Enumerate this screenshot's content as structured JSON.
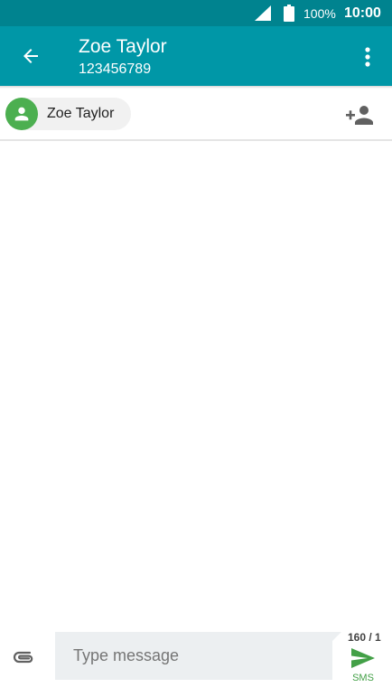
{
  "status_bar": {
    "battery_percent": "100%",
    "time": "10:00",
    "signal_icon": "cell-signal-icon",
    "battery_icon": "battery-full-icon"
  },
  "app_bar": {
    "title": "Zoe Taylor",
    "subtitle": "123456789",
    "back_icon": "arrow-back-icon",
    "menu_icon": "more-vert-icon"
  },
  "recipient": {
    "chip_label": "Zoe Taylor",
    "avatar_icon": "person-icon",
    "add_icon": "person-add-icon"
  },
  "compose": {
    "placeholder": "Type message",
    "value": "",
    "char_counter": "160 / 1",
    "send_label": "SMS",
    "attach_icon": "attachment-icon",
    "send_icon": "send-icon"
  },
  "colors": {
    "status_bar": "#00838f",
    "app_bar": "#0097a7",
    "avatar": "#4caf50",
    "send": "#43a047",
    "input_bg": "#eceff1"
  }
}
